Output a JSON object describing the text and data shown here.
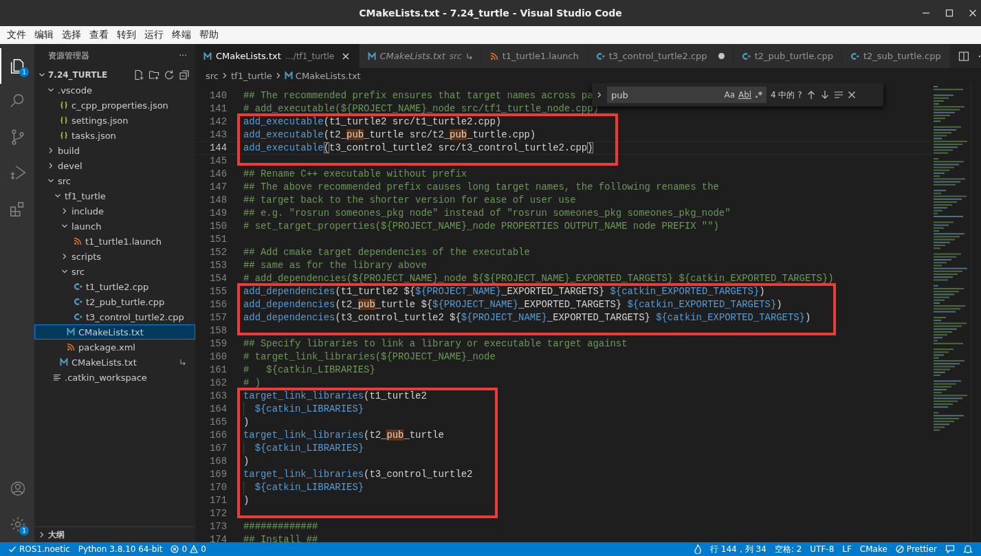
{
  "window": {
    "title": "CMakeLists.txt - 7.24_turtle - Visual Studio Code"
  },
  "menu": [
    "文件",
    "编辑",
    "选择",
    "查看",
    "转到",
    "运行",
    "终端",
    "帮助"
  ],
  "activity_bar": {
    "top": [
      {
        "kind": "explorer",
        "selected": true,
        "badge": "1"
      },
      {
        "kind": "search",
        "selected": false
      },
      {
        "kind": "source-control",
        "selected": false
      },
      {
        "kind": "run-debug",
        "selected": false
      },
      {
        "kind": "extensions",
        "selected": false
      }
    ],
    "bottom": [
      {
        "kind": "account"
      },
      {
        "kind": "settings",
        "badge": "1"
      }
    ]
  },
  "sidebar": {
    "title": "资源管理器",
    "more": "···",
    "root": {
      "label": "7.24_TURTLE",
      "expanded": true
    },
    "tree": [
      {
        "label": ".vscode",
        "kind": "folder",
        "expanded": true,
        "selected": false,
        "children": [
          {
            "label": "c_cpp_properties.json",
            "kind": "json",
            "selected": false
          },
          {
            "label": "settings.json",
            "kind": "json",
            "selected": false
          },
          {
            "label": "tasks.json",
            "kind": "json",
            "selected": false
          }
        ]
      },
      {
        "label": "build",
        "kind": "folder",
        "expanded": false,
        "selected": false
      },
      {
        "label": "devel",
        "kind": "folder",
        "expanded": false,
        "selected": false
      },
      {
        "label": "src",
        "kind": "folder",
        "expanded": true,
        "selected": false,
        "children": [
          {
            "label": "tf1_turtle",
            "kind": "folder",
            "expanded": true,
            "selected": false,
            "children": [
              {
                "label": "include",
                "kind": "folder",
                "expanded": false,
                "selected": false
              },
              {
                "label": "launch",
                "kind": "folder",
                "expanded": true,
                "selected": false,
                "children": [
                  {
                    "label": "t1_turtle1.launch",
                    "kind": "launch",
                    "selected": false
                  }
                ]
              },
              {
                "label": "scripts",
                "kind": "folder",
                "expanded": false,
                "selected": false
              },
              {
                "label": "src",
                "kind": "folder",
                "expanded": true,
                "selected": false,
                "children": [
                  {
                    "label": "t1_turtle2.cpp",
                    "kind": "cpp",
                    "selected": false
                  },
                  {
                    "label": "t2_pub_turtle.cpp",
                    "kind": "cpp",
                    "selected": false
                  },
                  {
                    "label": "t3_control_turtle2.cpp",
                    "kind": "cpp",
                    "selected": false
                  }
                ]
              },
              {
                "label": "CMakeLists.txt",
                "kind": "cmake",
                "selected": true
              },
              {
                "label": "package.xml",
                "kind": "launch",
                "selected": false
              }
            ]
          },
          {
            "label": "CMakeLists.txt",
            "kind": "cmake",
            "selected": false,
            "linked": true
          }
        ]
      },
      {
        "label": ".catkin_workspace",
        "kind": "text",
        "selected": false
      }
    ],
    "outline": {
      "label": "大纲",
      "expanded": false
    }
  },
  "tabs": [
    {
      "label": "CMakeLists.txt",
      "detail": "…/tf1_turtle",
      "kind": "cmake",
      "selected": true,
      "preview": false,
      "modified": false,
      "linked": false,
      "close": "×"
    },
    {
      "label": "CMakeLists.txt",
      "detail": "src",
      "kind": "cmake",
      "selected": false,
      "preview": true,
      "modified": false,
      "linked": true
    },
    {
      "label": "t1_turtle1.launch",
      "kind": "launch",
      "selected": false,
      "preview": false,
      "modified": false,
      "linked": false
    },
    {
      "label": "t3_control_turtle2.cpp",
      "kind": "cpp",
      "selected": false,
      "preview": false,
      "modified": true,
      "linked": false
    },
    {
      "label": "t2_pub_turtle.cpp",
      "kind": "cpp",
      "selected": false,
      "preview": false,
      "modified": false,
      "linked": false
    },
    {
      "label": "t2_sub_turtle.cpp",
      "kind": "cpp",
      "selected": false,
      "preview": false,
      "modified": false,
      "linked": false
    }
  ],
  "breadcrumb": [
    {
      "label": "src",
      "kind": "folder"
    },
    {
      "label": "tf1_turtle",
      "kind": "folder"
    },
    {
      "label": "CMakeLists.txt",
      "kind": "cmake"
    }
  ],
  "find": {
    "query": "pub",
    "options": [
      {
        "label": "Aa",
        "kind": "case"
      },
      {
        "label": "Abl",
        "kind": "word"
      },
      {
        "label": ".*",
        "kind": "regex"
      }
    ],
    "result": "4 中的 ?"
  },
  "editor": {
    "blocks": [
      {
        "boxed": false,
        "lines": [
          {
            "number": "140",
            "current": false,
            "indented": false,
            "segments": [
              {
                "text": "## The recommended prefix ensures that target names across pa",
                "kind": "comment"
              }
            ]
          },
          {
            "number": "141",
            "current": false,
            "indented": false,
            "segments": [
              {
                "text": "# add_executable(${PROJECT_NAME}_node src/tf1_turtle_node.cpp)",
                "kind": "comment"
              }
            ]
          }
        ]
      },
      {
        "boxed": true,
        "lines": [
          {
            "number": "142",
            "current": false,
            "indented": false,
            "segments": [
              {
                "text": "add_executable",
                "kind": "function"
              },
              {
                "text": "(t1_turtle2 src/t1_turtle2.cpp)",
                "kind": "text"
              }
            ]
          },
          {
            "number": "143",
            "current": false,
            "indented": false,
            "segments": [
              {
                "text": "add_executable",
                "kind": "function"
              },
              {
                "text": "(t2_",
                "kind": "text"
              },
              {
                "text": "pub",
                "kind": "match"
              },
              {
                "text": "_turtle src/t2_",
                "kind": "text"
              },
              {
                "text": "pub",
                "kind": "match"
              },
              {
                "text": "_turtle.cpp)",
                "kind": "text"
              }
            ]
          },
          {
            "number": "144",
            "current": true,
            "indented": false,
            "segments": [
              {
                "text": "add_executable",
                "kind": "function"
              },
              {
                "text": "(",
                "kind": "bracket"
              },
              {
                "text": "t3_control_turtle2 src/t3_control_turtle2.cpp",
                "kind": "text"
              },
              {
                "text": ")",
                "kind": "bracket"
              }
            ]
          },
          {
            "number": "145",
            "current": false,
            "indented": false
          }
        ]
      },
      {
        "boxed": false,
        "lines": [
          {
            "number": "146",
            "current": false,
            "indented": false,
            "segments": [
              {
                "text": "## Rename C++ executable without prefix",
                "kind": "comment"
              }
            ]
          },
          {
            "number": "147",
            "current": false,
            "indented": false,
            "segments": [
              {
                "text": "## The above recommended prefix causes long target names, the following renames the",
                "kind": "comment"
              }
            ]
          },
          {
            "number": "148",
            "current": false,
            "indented": false,
            "segments": [
              {
                "text": "## target back to the shorter version for ease of user use",
                "kind": "comment"
              }
            ]
          },
          {
            "number": "149",
            "current": false,
            "indented": false,
            "segments": [
              {
                "text": "## e.g. \"rosrun someones_pkg node\" instead of \"rosrun someones_pkg someones_pkg_node\"",
                "kind": "comment"
              }
            ]
          },
          {
            "number": "150",
            "current": false,
            "indented": false,
            "segments": [
              {
                "text": "# set_target_properties(${PROJECT_NAME}_node PROPERTIES OUTPUT_NAME node PREFIX \"\")",
                "kind": "comment"
              }
            ]
          },
          {
            "number": "151",
            "current": false,
            "indented": false
          },
          {
            "number": "152",
            "current": false,
            "indented": false,
            "segments": [
              {
                "text": "## Add cmake target dependencies of the executable",
                "kind": "comment"
              }
            ]
          },
          {
            "number": "153",
            "current": false,
            "indented": false,
            "segments": [
              {
                "text": "## same as for the library above",
                "kind": "comment"
              }
            ]
          },
          {
            "number": "154",
            "current": false,
            "indented": false,
            "segments": [
              {
                "text": "# add_dependencies(${PROJECT_NAME}_node ${${PROJECT_NAME}_EXPORTED_TARGETS} ${catkin_EXPORTED_TARGETS})",
                "kind": "comment"
              }
            ]
          }
        ]
      },
      {
        "boxed": true,
        "lines": [
          {
            "number": "155",
            "current": false,
            "indented": false,
            "segments": [
              {
                "text": "add_dependencies",
                "kind": "function"
              },
              {
                "text": "(t1_turtle2 ${",
                "kind": "text"
              },
              {
                "text": "${PROJECT_NAME}",
                "kind": "variable"
              },
              {
                "text": "_EXPORTED_TARGETS} ",
                "kind": "text"
              },
              {
                "text": "${catkin_EXPORTED_TARGETS}",
                "kind": "variable"
              },
              {
                "text": ")",
                "kind": "text"
              }
            ]
          },
          {
            "number": "156",
            "current": false,
            "indented": false,
            "segments": [
              {
                "text": "add_dependencies",
                "kind": "function"
              },
              {
                "text": "(t2_",
                "kind": "text"
              },
              {
                "text": "pub",
                "kind": "match"
              },
              {
                "text": "_turtle ${",
                "kind": "text"
              },
              {
                "text": "${PROJECT_NAME}",
                "kind": "variable"
              },
              {
                "text": "_EXPORTED_TARGETS} ",
                "kind": "text"
              },
              {
                "text": "${catkin_EXPORTED_TARGETS}",
                "kind": "variable"
              },
              {
                "text": ")",
                "kind": "text"
              }
            ]
          },
          {
            "number": "157",
            "current": false,
            "indented": false,
            "segments": [
              {
                "text": "add_dependencies",
                "kind": "function"
              },
              {
                "text": "(t3_control_turtle2 ${",
                "kind": "text"
              },
              {
                "text": "${PROJECT_NAME}",
                "kind": "variable"
              },
              {
                "text": "_EXPORTED_TARGETS} ",
                "kind": "text"
              },
              {
                "text": "${catkin_EXPORTED_TARGETS}",
                "kind": "variable"
              },
              {
                "text": ")",
                "kind": "text"
              }
            ]
          },
          {
            "number": "158",
            "current": false,
            "indented": false
          }
        ]
      },
      {
        "boxed": false,
        "lines": [
          {
            "number": "159",
            "current": false,
            "indented": false,
            "segments": [
              {
                "text": "## Specify libraries to link a library or executable target against",
                "kind": "comment"
              }
            ]
          },
          {
            "number": "160",
            "current": false,
            "indented": false,
            "segments": [
              {
                "text": "# target_link_libraries(${PROJECT_NAME}_node",
                "kind": "comment"
              }
            ]
          },
          {
            "number": "161",
            "current": false,
            "indented": false,
            "segments": [
              {
                "text": "#   ${catkin_LIBRARIES}",
                "kind": "comment"
              }
            ]
          },
          {
            "number": "162",
            "current": false,
            "indented": false,
            "segments": [
              {
                "text": "# )",
                "kind": "comment"
              }
            ]
          }
        ]
      },
      {
        "boxed": true,
        "lines": [
          {
            "number": "163",
            "current": false,
            "indented": false,
            "segments": [
              {
                "text": "target_link_libraries",
                "kind": "function"
              },
              {
                "text": "(t1_turtle2",
                "kind": "text"
              }
            ]
          },
          {
            "number": "164",
            "current": false,
            "indented": true,
            "segments": [
              {
                "text": "${catkin_LIBRARIES}",
                "kind": "variable"
              }
            ]
          },
          {
            "number": "165",
            "current": false,
            "indented": false,
            "segments": [
              {
                "text": ")",
                "kind": "text"
              }
            ]
          },
          {
            "number": "166",
            "current": false,
            "indented": false,
            "segments": [
              {
                "text": "target_link_libraries",
                "kind": "function"
              },
              {
                "text": "(t2_",
                "kind": "text"
              },
              {
                "text": "pub",
                "kind": "match"
              },
              {
                "text": "_turtle",
                "kind": "text"
              }
            ]
          },
          {
            "number": "167",
            "current": false,
            "indented": true,
            "segments": [
              {
                "text": "${catkin_LIBRARIES}",
                "kind": "variable"
              }
            ]
          },
          {
            "number": "168",
            "current": false,
            "indented": false,
            "segments": [
              {
                "text": ")",
                "kind": "text"
              }
            ]
          },
          {
            "number": "169",
            "current": false,
            "indented": false,
            "segments": [
              {
                "text": "target_link_libraries",
                "kind": "function"
              },
              {
                "text": "(t3_control_turtle2",
                "kind": "text"
              }
            ]
          },
          {
            "number": "170",
            "current": false,
            "indented": true,
            "segments": [
              {
                "text": "${catkin_LIBRARIES}",
                "kind": "variable"
              }
            ]
          },
          {
            "number": "171",
            "current": false,
            "indented": false,
            "segments": [
              {
                "text": ")",
                "kind": "text"
              }
            ]
          },
          {
            "number": "172",
            "current": false,
            "indented": false
          }
        ]
      },
      {
        "boxed": false,
        "lines": [
          {
            "number": "173",
            "current": false,
            "indented": false,
            "segments": [
              {
                "text": "#############",
                "kind": "comment"
              }
            ]
          },
          {
            "number": "174",
            "current": false,
            "indented": false,
            "segments": [
              {
                "text": "## Install ##",
                "kind": "comment"
              }
            ]
          }
        ]
      }
    ]
  },
  "status_bar": {
    "left": [
      {
        "kind": "remote",
        "text": "ROS1.noetic"
      },
      {
        "kind": "text",
        "text": "Python 3.8.10 64-bit"
      },
      {
        "kind": "problems",
        "errors": "0",
        "warnings": "0"
      }
    ],
    "right": [
      {
        "kind": "flame"
      },
      {
        "kind": "text",
        "text": "行 144，列 34"
      },
      {
        "kind": "text",
        "text": "空格: 2"
      },
      {
        "kind": "text",
        "text": "UTF-8"
      },
      {
        "kind": "text",
        "text": "LF"
      },
      {
        "kind": "text",
        "text": "CMake"
      },
      {
        "kind": "prettier",
        "text": "Prettier"
      },
      {
        "kind": "feedback"
      },
      {
        "kind": "bell"
      }
    ]
  }
}
